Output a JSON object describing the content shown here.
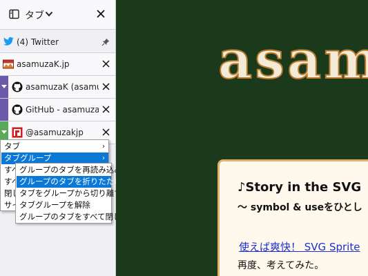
{
  "sidebar": {
    "title": "タブ",
    "pinned_tab": {
      "label": "(4) Twitter"
    },
    "tabs": [
      {
        "label": "asamuzaK.jp"
      },
      {
        "label": "asamuzaK (asamuza"
      },
      {
        "label": "GitHub - asamuza"
      },
      {
        "label": "@asamuzakjp"
      }
    ],
    "group_colors": [
      "#6a5aa8",
      "#5aa85a"
    ]
  },
  "context_menu": {
    "items": [
      {
        "label": "タブ",
        "has_submenu": true
      },
      {
        "label": "タブグループ",
        "has_submenu": true,
        "selected": true
      },
      {
        "label": "すべ"
      },
      {
        "label": "すべ"
      },
      {
        "label": "閉じ"
      },
      {
        "label": "サイ"
      }
    ]
  },
  "submenu": {
    "items": [
      {
        "label": "グループのタブを再読み込み"
      },
      {
        "label": "グループのタブを折りたたむ",
        "selected": true
      },
      {
        "label": "タブをグループから切り離す"
      },
      {
        "label": "タブグループを解除"
      },
      {
        "label": "グループのタブをすべて閉じる"
      }
    ]
  },
  "page": {
    "logo_text": "asam",
    "card_title": "♪Story in the SVG",
    "card_subtitle": "〜 symbol & useをひとし",
    "card_link": "使えば爽快！ SVG Sprite",
    "card_text": "再度、考えてみた。"
  },
  "colors": {
    "page_bg": "#1b3a1c",
    "accent_select": "#0a78d7",
    "card_border": "#e2b26c",
    "link": "#1a2fd6"
  }
}
